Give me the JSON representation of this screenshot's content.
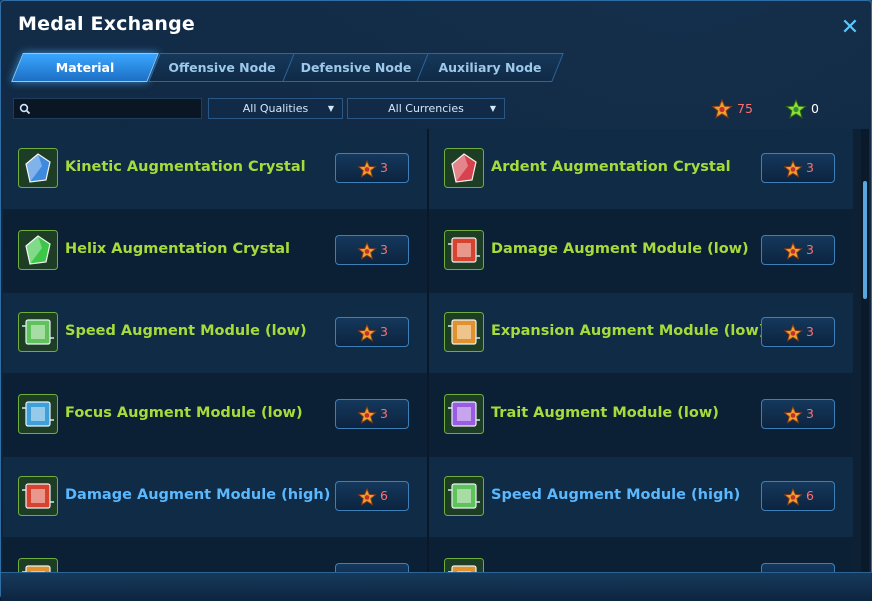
{
  "window": {
    "title": "Medal Exchange"
  },
  "tabs": [
    {
      "label": "Material",
      "active": true
    },
    {
      "label": "Offensive Node",
      "active": false
    },
    {
      "label": "Defensive Node",
      "active": false
    },
    {
      "label": "Auxiliary Node",
      "active": false
    }
  ],
  "filters": {
    "search_placeholder": "",
    "quality": "All Qualities",
    "currency": "All Currencies"
  },
  "currencies": [
    {
      "icon": "orange-medal-icon",
      "value": "75",
      "color": "#ff6f6f"
    },
    {
      "icon": "green-medal-icon",
      "value": "0",
      "color": "#ffffff"
    }
  ],
  "items_left": [
    {
      "name": "Kinetic Augmentation Crystal",
      "price": "3",
      "icon": "blue-crystal-icon",
      "name_color": "#a6dc3a",
      "icon_color": "#3f8fe8"
    },
    {
      "name": "Helix Augmentation Crystal",
      "price": "3",
      "icon": "green-crystal-icon",
      "name_color": "#a6dc3a",
      "icon_color": "#3ecf4a"
    },
    {
      "name": "Speed Augment Module (low)",
      "price": "3",
      "icon": "green-chip-icon",
      "name_color": "#a6dc3a",
      "icon_color": "#5fc25a"
    },
    {
      "name": "Focus Augment Module (low)",
      "price": "3",
      "icon": "blue-chip-icon",
      "name_color": "#a6dc3a",
      "icon_color": "#3f9fd8"
    },
    {
      "name": "Damage Augment Module (high)",
      "price": "6",
      "icon": "red-chip-icon",
      "name_color": "#5ab8ff",
      "icon_color": "#d8432e"
    }
  ],
  "items_right": [
    {
      "name": "Ardent Augmentation Crystal",
      "price": "3",
      "icon": "red-crystal-icon",
      "name_color": "#a6dc3a",
      "icon_color": "#e04350"
    },
    {
      "name": "Damage Augment Module (low)",
      "price": "3",
      "icon": "red-chip-icon",
      "name_color": "#a6dc3a",
      "icon_color": "#d8432e"
    },
    {
      "name": "Expansion Augment Module (low)",
      "price": "3",
      "icon": "orange-chip-icon",
      "name_color": "#a6dc3a",
      "icon_color": "#e0922e"
    },
    {
      "name": "Trait Augment Module (low)",
      "price": "3",
      "icon": "purple-chip-icon",
      "name_color": "#a6dc3a",
      "icon_color": "#9a5ce0"
    },
    {
      "name": "Speed Augment Module (high)",
      "price": "6",
      "icon": "green-chip-icon",
      "name_color": "#5ab8ff",
      "icon_color": "#5fc25a"
    }
  ],
  "colors": {
    "accent": "#3aa6ff",
    "price_text": "#ff6f6f",
    "standard_item": "#a6dc3a",
    "rare_item": "#5ab8ff"
  }
}
